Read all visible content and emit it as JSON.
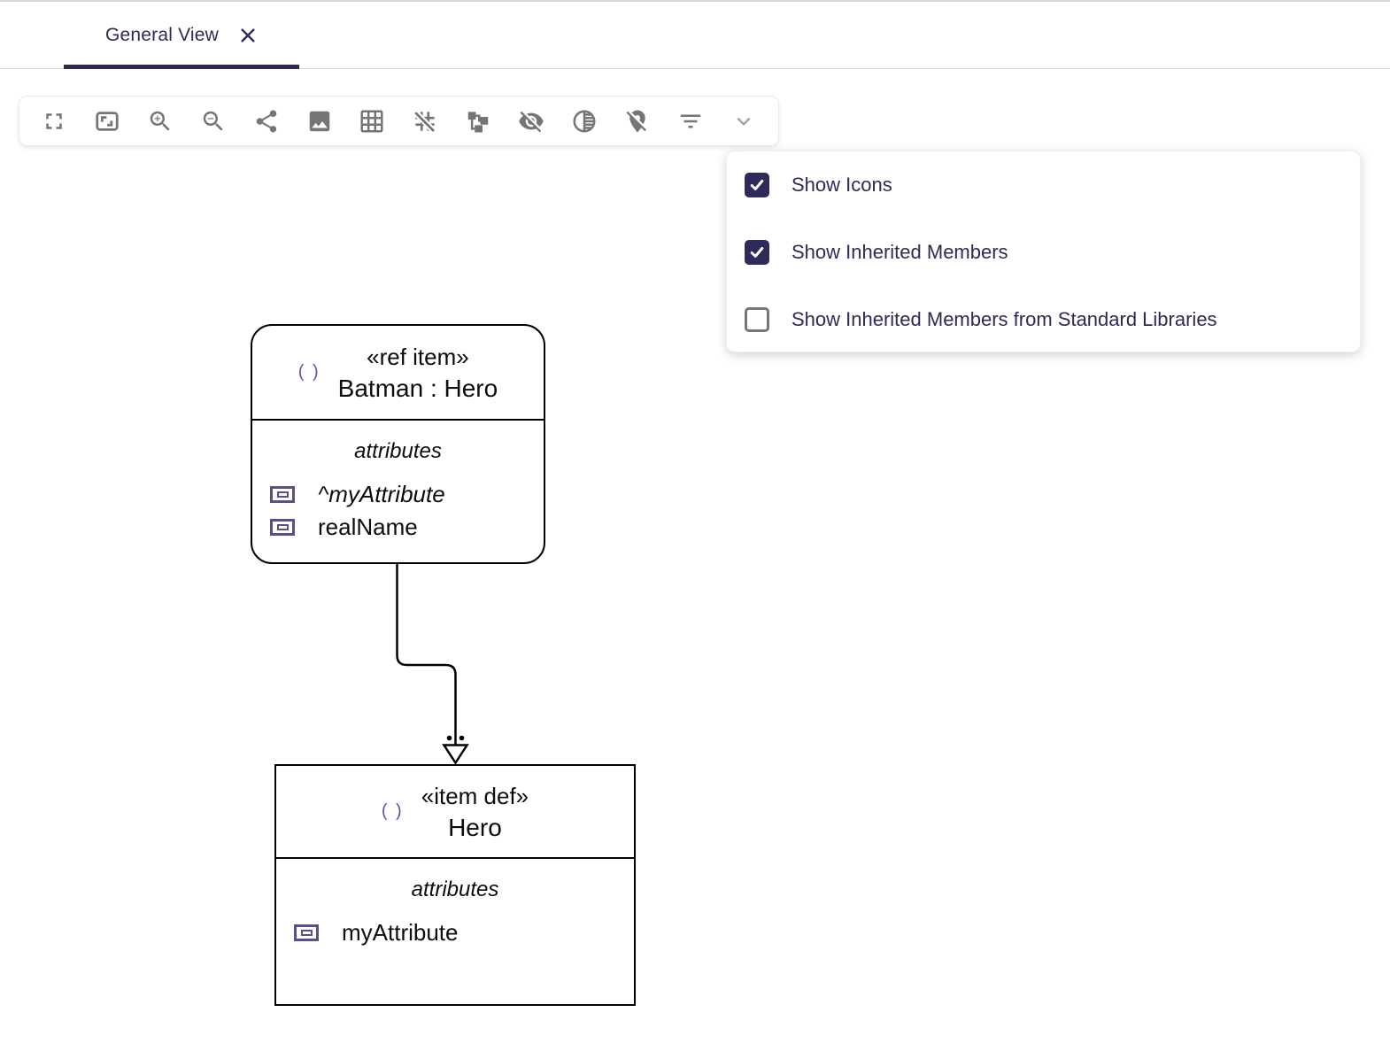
{
  "tab_bar": {
    "active_tab": {
      "label": "General View"
    }
  },
  "toolbar": {
    "icon_color": "#757575",
    "buttons": [
      "fullscreen",
      "fit-to-screen",
      "zoom-in",
      "zoom-out",
      "share",
      "export-image",
      "grid-on",
      "grid-off",
      "schema-layout",
      "visibility-off",
      "tonality",
      "location-off",
      "filter",
      "expand-more"
    ]
  },
  "filter_menu": {
    "items": [
      {
        "label": "Show Icons",
        "checked": true
      },
      {
        "label": "Show Inherited Members",
        "checked": true
      },
      {
        "label": "Show Inherited Members from Standard Libraries",
        "checked": false
      }
    ]
  },
  "diagram": {
    "nodes": [
      {
        "icon": "( )",
        "stereotype": "«ref item»",
        "name": "Batman : Hero",
        "compartments": [
          {
            "label": "attributes",
            "rows": [
              {
                "text": "^myAttribute",
                "inherited": true
              },
              {
                "text": "realName",
                "inherited": false
              }
            ]
          }
        ]
      },
      {
        "icon": "( )",
        "stereotype": "«item def»",
        "name": "Hero",
        "compartments": [
          {
            "label": "attributes",
            "rows": [
              {
                "text": "myAttribute",
                "inherited": false
              }
            ]
          }
        ]
      }
    ],
    "edge": {
      "from": "Batman : Hero",
      "to": "Hero",
      "arrowhead": "hollow-triangle",
      "decoration": "two-dots"
    }
  },
  "colors": {
    "accent_navy": "#2d2a56",
    "tab_underline": "#2e2a57",
    "toolbar_icon_gray": "#757575",
    "checkbox_checked": "#2e2a5a",
    "member_icon_purple": "#56508c",
    "paren_icon_purple": "#5d55a7",
    "node_border": "#000000"
  }
}
